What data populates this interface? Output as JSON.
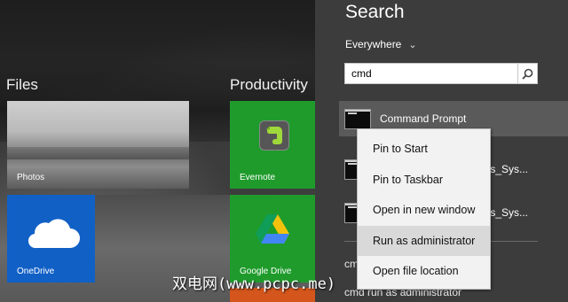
{
  "start_screen": {
    "groups": [
      {
        "title": "Files"
      },
      {
        "title": "Productivity"
      }
    ],
    "tiles": {
      "photos": {
        "label": "Photos",
        "color": "#9c9c9c"
      },
      "onedrive": {
        "label": "OneDrive",
        "color": "#1160c6",
        "icon": "cloud-icon"
      },
      "evernote": {
        "label": "Evernote",
        "color": "#1f9b2c",
        "icon": "evernote-icon"
      },
      "google_drive": {
        "label": "Google Drive",
        "color": "#1f9b2c",
        "icon": "google-drive-icon"
      }
    }
  },
  "search": {
    "title": "Search",
    "scope": "Everywhere",
    "query": "cmd",
    "results": [
      {
        "label": "Command Prompt",
        "icon": "command-prompt-icon",
        "selected": true
      },
      {
        "label": "",
        "tail": "ows_Sys...",
        "icon": "command-prompt-icon"
      },
      {
        "label": "",
        "tail": "ows_Sys...",
        "icon": "command-prompt-icon"
      }
    ],
    "suggestions": [
      {
        "text": "cmd"
      },
      {
        "text": "cmd run as administrator"
      }
    ]
  },
  "context_menu": {
    "items": [
      {
        "label": "Pin to Start"
      },
      {
        "label": "Pin to Taskbar"
      },
      {
        "label": "Open in new window"
      },
      {
        "label": "Run as administrator",
        "highlighted": true
      },
      {
        "label": "Open file location"
      }
    ]
  },
  "watermark": "双电网(www.pcpc.me)"
}
